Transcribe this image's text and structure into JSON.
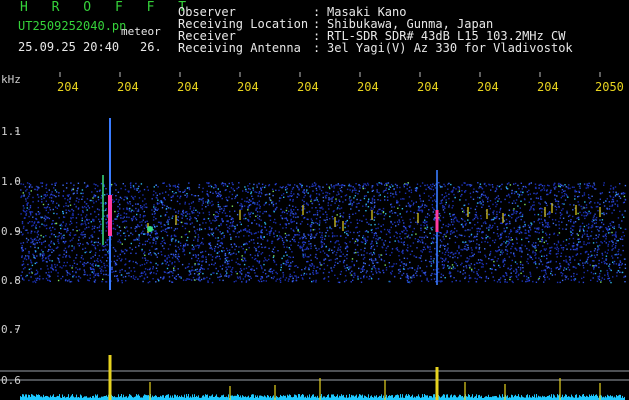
{
  "header": {
    "app_title": "H R O F F T",
    "filename": "UT2509252040.pn",
    "mode": "meteor",
    "date_time": "25.09.25 20:40",
    "count": "26.",
    "fields": [
      {
        "label": "Observer",
        "sep": ":",
        "value": "Masaki Kano"
      },
      {
        "label": "Receiving Location",
        "sep": ":",
        "value": "Shibukawa, Gunma, Japan"
      },
      {
        "label": "Receiver",
        "sep": ":",
        "value": "RTL-SDR SDR# 43dB L15 103.2MHz CW"
      },
      {
        "label": "Receiving Antenna",
        "sep": ":",
        "value": "3el Yagi(V) Az 330 for Vladivostok"
      }
    ]
  },
  "y_axis": {
    "unit": "kHz",
    "ticks": [
      "1.1",
      "1.0",
      "0.9",
      "0.8",
      "0.7",
      "0.6"
    ]
  },
  "x_axis": {
    "ticks": [
      "204",
      "204",
      "204",
      "204",
      "204",
      "204",
      "204",
      "204",
      "204",
      "2050"
    ]
  },
  "colors": {
    "background": "#000000",
    "label_green": "#35d23a",
    "tick_yellow": "#e7d31f",
    "text_white": "#e8e8e8",
    "noise_blue": "#1f35c8",
    "echo_magenta": "#ff3aa0",
    "baseline_cyan": "#1ec8ff"
  }
}
